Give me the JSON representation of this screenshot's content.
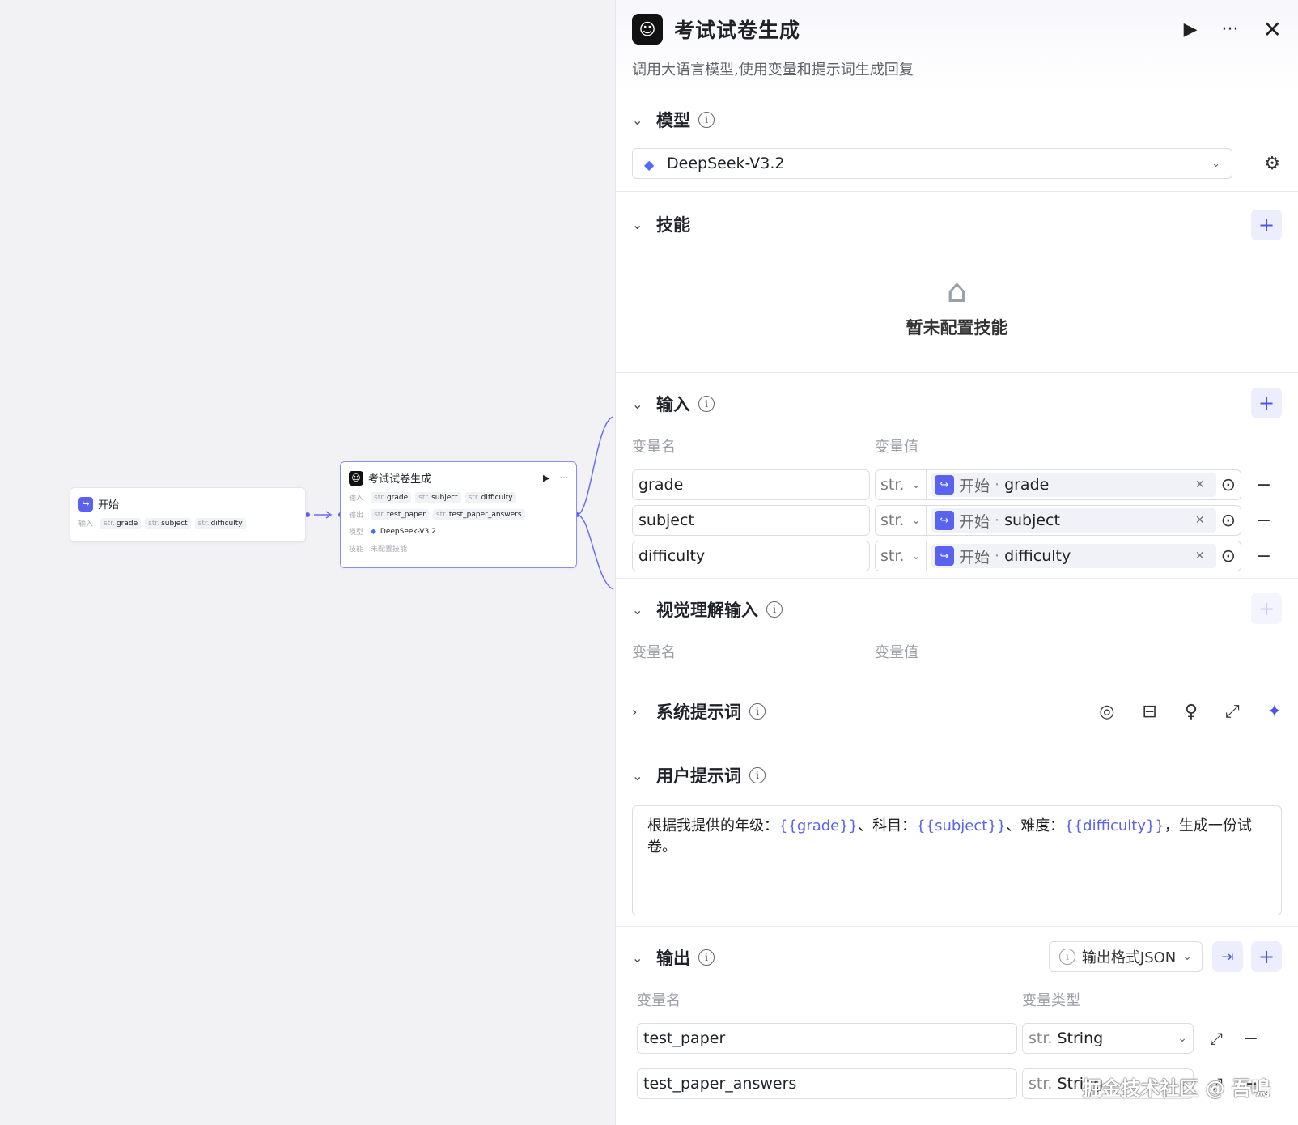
{
  "canvas": {
    "start_node": {
      "title": "开始",
      "input_label": "输入",
      "inputs": [
        {
          "type": "str.",
          "name": "grade"
        },
        {
          "type": "str.",
          "name": "subject"
        },
        {
          "type": "str.",
          "name": "difficulty"
        }
      ]
    },
    "llm_node": {
      "title": "考试试卷生成",
      "input_label": "输入",
      "inputs": [
        {
          "type": "str.",
          "name": "grade"
        },
        {
          "type": "str.",
          "name": "subject"
        },
        {
          "type": "str.",
          "name": "difficulty"
        }
      ],
      "output_label": "输出",
      "outputs": [
        {
          "type": "str.",
          "name": "test_paper"
        },
        {
          "type": "str.",
          "name": "test_paper_answers"
        }
      ],
      "model_label": "模型",
      "model": "DeepSeek-V3.2",
      "skill_label": "技能",
      "skill_value": "未配置技能"
    }
  },
  "panel": {
    "title": "考试试卷生成",
    "description": "调用大语言模型,使用变量和提示词生成回复",
    "model": {
      "title": "模型",
      "selected": "DeepSeek-V3.2"
    },
    "skills": {
      "title": "技能",
      "empty": "暂未配置技能"
    },
    "inputs": {
      "title": "输入",
      "col_name": "变量名",
      "col_value": "变量值",
      "rows": [
        {
          "name": "grade",
          "type": "str.",
          "ref_node": "开始",
          "ref_var": "grade"
        },
        {
          "name": "subject",
          "type": "str.",
          "ref_node": "开始",
          "ref_var": "subject"
        },
        {
          "name": "difficulty",
          "type": "str.",
          "ref_node": "开始",
          "ref_var": "difficulty"
        }
      ]
    },
    "vision": {
      "title": "视觉理解输入",
      "col_name": "变量名",
      "col_value": "变量值"
    },
    "system_prompt": {
      "title": "系统提示词"
    },
    "user_prompt": {
      "title": "用户提示词",
      "parts": [
        "根据我提供的年级：",
        "{{grade}}",
        "、科目：",
        "{{subject}}",
        "、难度：",
        "{{difficulty}}",
        "，生成一份试卷。"
      ]
    },
    "outputs": {
      "title": "输出",
      "format_label": "输出格式JSON",
      "col_name": "变量名",
      "col_type": "变量类型",
      "rows": [
        {
          "name": "test_paper",
          "type_prefix": "str.",
          "type": "String"
        },
        {
          "name": "test_paper_answers",
          "type_prefix": "str.",
          "type": "String"
        }
      ]
    }
  },
  "watermark": "掘金技术社区 @ 吾鳴",
  "colors": {
    "accent": "#5a63ef",
    "accent_bg": "#eceefd"
  },
  "icons": [
    "play-icon",
    "more-icon",
    "close-icon",
    "info-icon",
    "gear-icon",
    "plus-icon",
    "chevron-down-icon",
    "chevron-right-icon",
    "target-icon",
    "minus-icon",
    "expand-icon",
    "sparkle-icon"
  ]
}
